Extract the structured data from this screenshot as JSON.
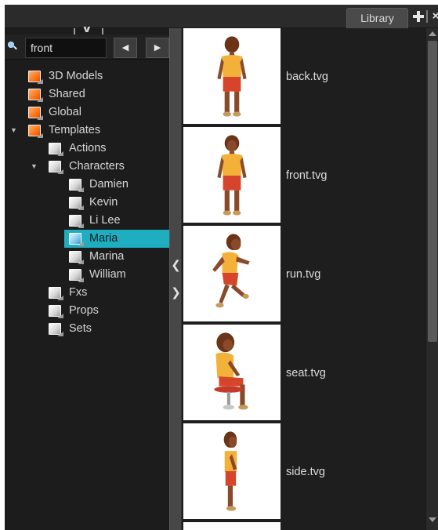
{
  "header": {
    "tab_label": "Library",
    "plus_icon": "plus-icon",
    "close_icon": "close-icon",
    "close_glyph": "×"
  },
  "search": {
    "value": "front",
    "icon": "search-icon",
    "prev_glyph": "◀",
    "next_glyph": "▶"
  },
  "tree": {
    "items": [
      {
        "label": "3D Models",
        "icon": "folder-orange-icon",
        "expandable": false
      },
      {
        "label": "Shared",
        "icon": "folder-orange-icon",
        "expandable": false
      },
      {
        "label": "Global",
        "icon": "folder-orange-icon",
        "expandable": false
      },
      {
        "label": "Templates",
        "icon": "folder-orange-icon",
        "expanded": true
      },
      {
        "label": "Actions",
        "icon": "folder-gray-icon",
        "expandable": false
      },
      {
        "label": "Characters",
        "icon": "folder-gray-icon",
        "expanded": true
      },
      {
        "label": "Damien",
        "icon": "folder-gray-icon"
      },
      {
        "label": "Kevin",
        "icon": "folder-gray-icon"
      },
      {
        "label": "Li Lee",
        "icon": "folder-gray-icon"
      },
      {
        "label": "Maria",
        "icon": "folder-blue-icon",
        "selected": true
      },
      {
        "label": "Marina",
        "icon": "folder-gray-icon"
      },
      {
        "label": "William",
        "icon": "folder-gray-icon"
      },
      {
        "label": "Fxs",
        "icon": "folder-gray-icon"
      },
      {
        "label": "Props",
        "icon": "folder-gray-icon"
      },
      {
        "label": "Sets",
        "icon": "folder-gray-icon"
      }
    ],
    "expand_glyph": "▼"
  },
  "splitter": {
    "left_glyph": "❮",
    "right_glyph": "❯"
  },
  "files": [
    {
      "name": "back.tvg",
      "pose": "back"
    },
    {
      "name": "front.tvg",
      "pose": "front"
    },
    {
      "name": "run.tvg",
      "pose": "run"
    },
    {
      "name": "seat.tvg",
      "pose": "seat"
    },
    {
      "name": "side.tvg",
      "pose": "side"
    }
  ],
  "colors": {
    "selection": "#1eaebf",
    "panel_bg": "#1c1c1c",
    "skin": "#8a4a2a",
    "shirt": "#f3b13a",
    "shorts": "#d6452b"
  }
}
